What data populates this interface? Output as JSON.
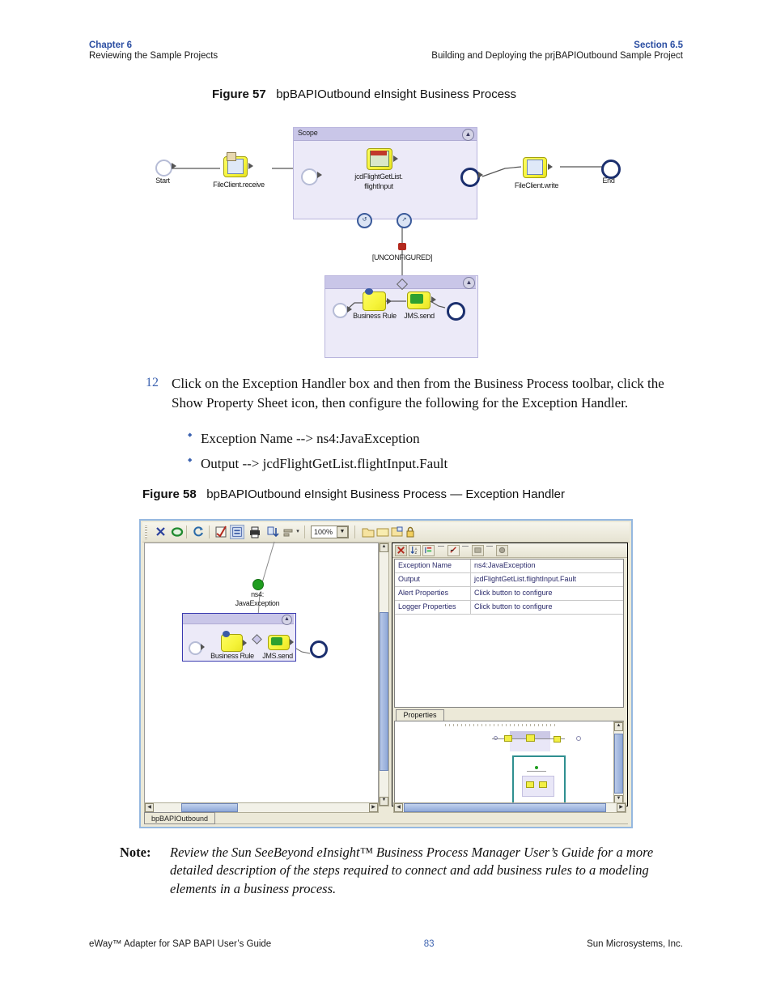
{
  "header": {
    "left_top": "Chapter 6",
    "left_bottom": "Reviewing the Sample Projects",
    "right_top": "Section 6.5",
    "right_bottom": "Building and Deploying the prjBAPIOutbound Sample Project"
  },
  "figure57": {
    "caption_label": "Figure 57",
    "caption_text": "bpBAPIOutbound eInsight Business Process",
    "scope_label": "Scope",
    "nodes": {
      "start": "Start",
      "file_receive": "FileClient.receive",
      "jcd": "jcdFlightGetList.\nflightInput",
      "jcd_line1": "jcdFlightGetList.",
      "jcd_line2": "flightInput",
      "file_write": "FileClient.write",
      "end": "End",
      "unconfigured": "[UNCONFIGURED]",
      "business_rule": "Business Rule",
      "jms_send": "JMS.send"
    }
  },
  "step12": {
    "number": "12",
    "text": "Click on the Exception Handler box and then from the Business Process toolbar, click the Show Property Sheet icon, then configure the following for the Exception Handler.",
    "bullets": [
      "Exception Name --> ns4:JavaException",
      "Output --> jcdFlightGetList.flightInput.Fault"
    ]
  },
  "figure58": {
    "caption_label": "Figure 58",
    "caption_text": "bpBAPIOutbound eInsight Business Process — Exception Handler",
    "toolbar": {
      "zoom_value": "100%",
      "buttons": [
        {
          "name": "cut-icon",
          "glyph": "✄"
        },
        {
          "name": "link-icon",
          "glyph": "⬡"
        },
        {
          "name": "refresh-icon",
          "glyph": "↻"
        },
        {
          "name": "validate-icon",
          "glyph": "☑"
        },
        {
          "name": "show-property-sheet-icon",
          "glyph": "▣"
        },
        {
          "name": "print-icon",
          "glyph": "⎙"
        },
        {
          "name": "sort-icon",
          "glyph": "⇅"
        },
        {
          "name": "align-icon",
          "glyph": "▤"
        },
        {
          "name": "open-folder-icon",
          "glyph": "▭"
        },
        {
          "name": "folder-icon",
          "glyph": "▭"
        },
        {
          "name": "save-icon",
          "glyph": "▤"
        },
        {
          "name": "lock-icon",
          "glyph": "⬚"
        }
      ]
    },
    "property_toolbar": {
      "buttons": [
        {
          "name": "exception-icon",
          "glyph": "✗"
        },
        {
          "name": "sort-az-icon",
          "glyph": "↓"
        },
        {
          "name": "categorize-icon",
          "glyph": "≡"
        },
        {
          "name": "edit-icon",
          "glyph": "✎"
        },
        {
          "name": "box-icon",
          "glyph": "▭"
        },
        {
          "name": "circle-icon",
          "glyph": "●"
        }
      ]
    },
    "properties": {
      "rows": [
        {
          "key": "Exception Name",
          "value": "ns4:JavaException"
        },
        {
          "key": "Output",
          "value": "jcdFlightGetList.flightInput.Fault"
        },
        {
          "key": "Alert Properties",
          "value": "Click button to configure"
        },
        {
          "key": "Logger Properties",
          "value": "Click button to configure"
        }
      ]
    },
    "properties_tab_label": "Properties",
    "canvas": {
      "exception_line1": "ns4:",
      "exception_line2": "JavaException",
      "business_rule": "Business Rule",
      "jms_send": "JMS.send"
    },
    "status_tab": "bpBAPIOutbound"
  },
  "note": {
    "label": "Note:",
    "text": "Review the Sun SeeBeyond eInsight™ Business Process Manager User’s Guide for a more detailed description of the steps required to connect and add business rules to a modeling elements in a business process."
  },
  "footer": {
    "left": "eWay™ Adapter for SAP BAPI User’s Guide",
    "page": "83",
    "right": "Sun Microsystems, Inc."
  },
  "colors": {
    "accent_blue": "#2b4ea2",
    "step_number": "#3d63b0",
    "scope_fill": "#eceaf8",
    "scope_header": "#c9c6e8",
    "node_yellow": "#f6f43a",
    "end_ring": "#1b2f6e"
  }
}
